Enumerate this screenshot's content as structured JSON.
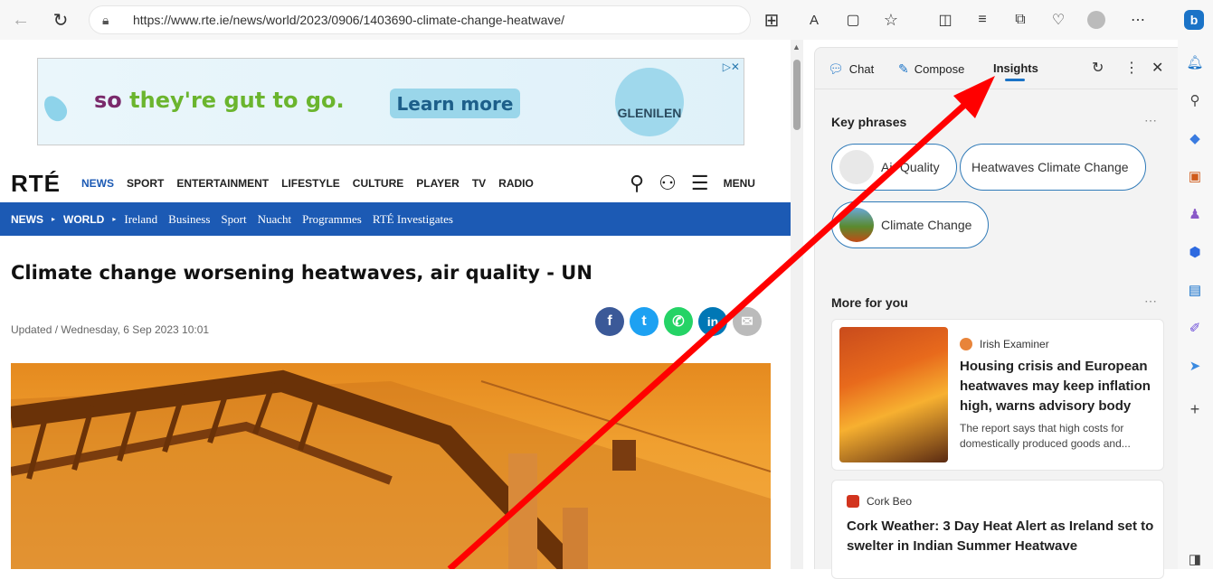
{
  "browser": {
    "url": "https://www.rte.ie/news/world/2023/0906/1403690-climate-change-heatwave/"
  },
  "ad": {
    "text_1": "so ",
    "text_2": "they're gut to go.",
    "button": "Learn more",
    "logo": "GLENILEN"
  },
  "site": {
    "logo": "RTÉ",
    "nav": [
      "NEWS",
      "SPORT",
      "ENTERTAINMENT",
      "LIFESTYLE",
      "CULTURE",
      "PLAYER",
      "TV",
      "RADIO"
    ],
    "menu_label": "MENU",
    "subnav": {
      "news": "NEWS",
      "world": "WORLD",
      "items": [
        "Ireland",
        "Business",
        "Sport",
        "Nuacht",
        "Programmes",
        "RTÉ Investigates"
      ]
    }
  },
  "article": {
    "headline": "Climate change worsening heatwaves, air quality - UN",
    "updated": "Updated / Wednesday, 6 Sep 2023 10:01"
  },
  "sidebar": {
    "tabs": {
      "chat": "Chat",
      "compose": "Compose",
      "insights": "Insights"
    },
    "key_phrases_title": "Key phrases",
    "chips": [
      "Air Quality",
      "Heatwaves Climate Change",
      "Climate Change"
    ],
    "more_title": "More for you",
    "cards": [
      {
        "source": "Irish Examiner",
        "title": "Housing crisis and European heatwaves may keep inflation high, warns advisory body",
        "desc": "The report says that high costs for domestically produced goods and..."
      },
      {
        "source": "Cork Beo",
        "title": "Cork Weather: 3 Day Heat Alert as Ireland set to swelter in Indian Summer Heatwave"
      }
    ]
  },
  "colors": {
    "rte_blue": "#1c5ab4",
    "accent": "#1a73c7",
    "arrow": "#ff0000"
  }
}
